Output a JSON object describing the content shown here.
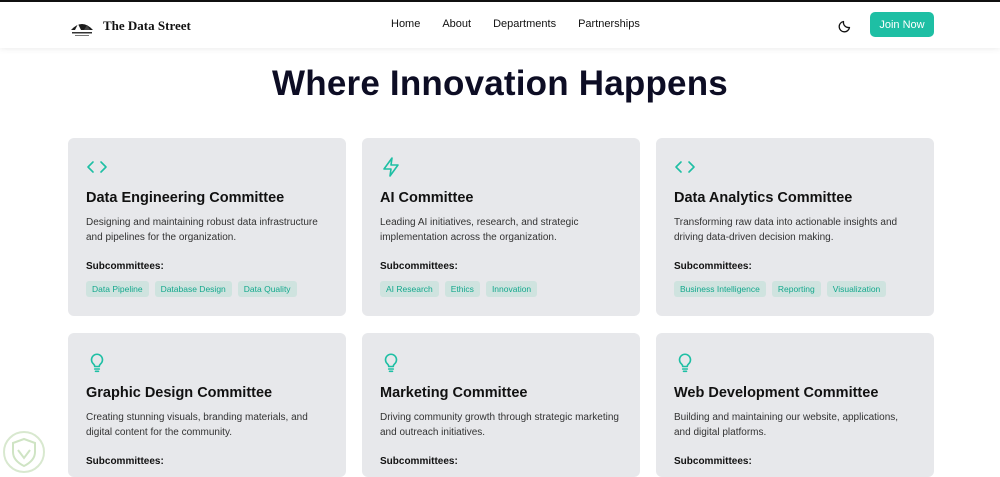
{
  "nav": {
    "brand": "The Data Street",
    "items": [
      "Home",
      "About",
      "Departments",
      "Partnerships"
    ],
    "join_label": "Join Now",
    "accent": "#1ebfa4",
    "theme_icon": "moon-icon"
  },
  "hero": {
    "title": "Where Innovation Happens"
  },
  "committees": [
    {
      "icon": "code-icon",
      "title": "Data Engineering Committee",
      "description": "Designing and maintaining robust data infrastructure and pipelines for the organization.",
      "sub_label": "Subcommittees:",
      "subcommittees": [
        "Data Pipeline",
        "Database Design",
        "Data Quality"
      ]
    },
    {
      "icon": "lightning-icon",
      "title": "AI Committee",
      "description": "Leading AI initiatives, research, and strategic implementation across the organization.",
      "sub_label": "Subcommittees:",
      "subcommittees": [
        "AI Research",
        "Ethics",
        "Innovation"
      ]
    },
    {
      "icon": "code-icon",
      "title": "Data Analytics Committee",
      "description": "Transforming raw data into actionable insights and driving data-driven decision making.",
      "sub_label": "Subcommittees:",
      "subcommittees": [
        "Business Intelligence",
        "Reporting",
        "Visualization"
      ]
    },
    {
      "icon": "lightbulb-icon",
      "title": "Graphic Design Committee",
      "description": "Creating stunning visuals, branding materials, and digital content for the community.",
      "sub_label": "Subcommittees:",
      "subcommittees": []
    },
    {
      "icon": "lightbulb-icon",
      "title": "Marketing Committee",
      "description": "Driving community growth through strategic marketing and outreach initiatives.",
      "sub_label": "Subcommittees:",
      "subcommittees": []
    },
    {
      "icon": "lightbulb-icon",
      "title": "Web Development Committee",
      "description": "Building and maintaining our website, applications, and digital platforms.",
      "sub_label": "Subcommittees:",
      "subcommittees": []
    }
  ]
}
